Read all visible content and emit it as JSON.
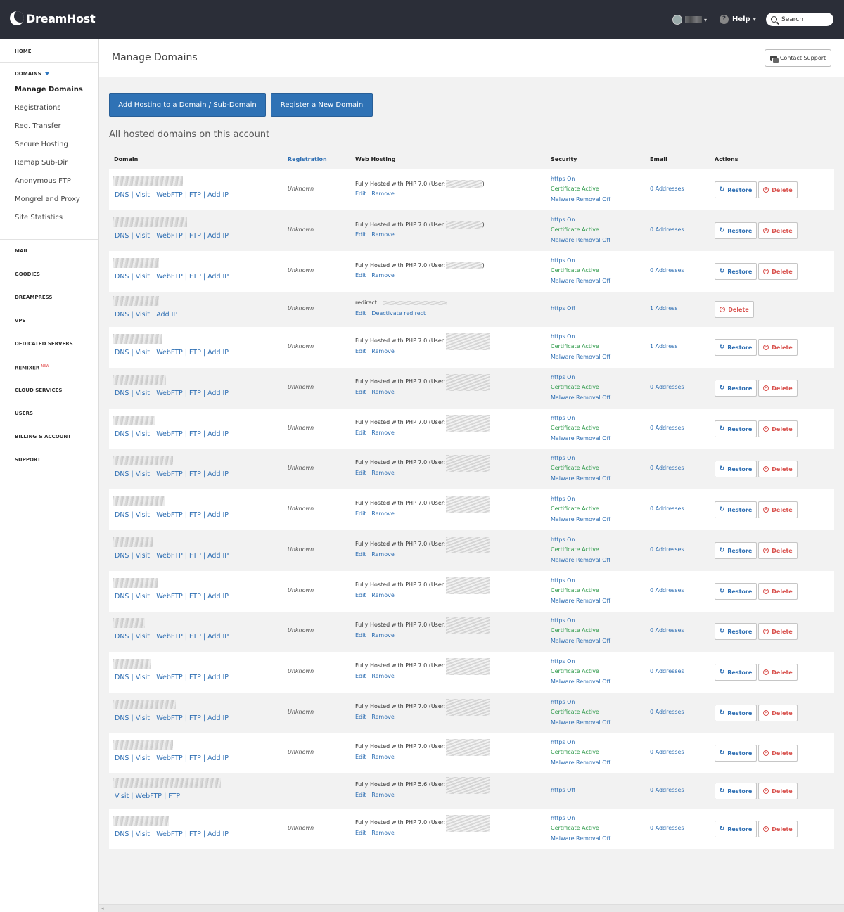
{
  "brand": {
    "name": "DreamHost"
  },
  "header": {
    "help_label": "Help",
    "search_placeholder": "Search"
  },
  "sidebar": {
    "home": "HOME",
    "domains": "DOMAINS",
    "domain_items": [
      "Manage Domains",
      "Registrations",
      "Reg. Transfer",
      "Secure Hosting",
      "Remap Sub-Dir",
      "Anonymous FTP",
      "Mongrel and Proxy",
      "Site Statistics"
    ],
    "categories": [
      "MAIL",
      "GOODIES",
      "DREAMPRESS",
      "VPS",
      "DEDICATED SERVERS",
      "REMIXER",
      "CLOUD SERVICES",
      "USERS",
      "BILLING & ACCOUNT",
      "SUPPORT"
    ],
    "new_badge": "NEW"
  },
  "page": {
    "title": "Manage Domains",
    "contact_support": "Contact Support",
    "add_hosting_button": "Add Hosting to a Domain / Sub-Domain",
    "register_button": "Register a New Domain",
    "section_title": "All hosted domains on this account"
  },
  "table": {
    "headers": {
      "domain": "Domain",
      "registration": "Registration",
      "hosting": "Web Hosting",
      "security": "Security",
      "email": "Email",
      "actions": "Actions"
    },
    "labels": {
      "dns": "DNS",
      "visit": "Visit",
      "webftp": "WebFTP",
      "ftp": "FTP",
      "add_ip": "Add IP",
      "unknown": "Unknown",
      "hosted_php70": "Fully Hosted with PHP 7.0 (User:",
      "hosted_php56": "Fully Hosted with PHP 5.6 (User:",
      "close_paren": ")",
      "redirect": "redirect :",
      "edit": "Edit",
      "remove": "Remove",
      "deactivate_redirect": "Deactivate redirect",
      "https_on": "https On",
      "https_off": "https Off",
      "cert_active": "Certificate Active",
      "malware_off": "Malware Removal Off",
      "zero_addresses": "0 Addresses",
      "one_address": "1 Address",
      "restore": "Restore",
      "delete": "Delete"
    }
  }
}
